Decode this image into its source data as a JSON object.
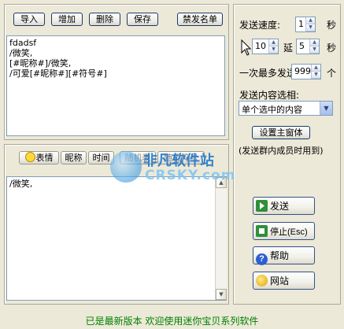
{
  "toolbar": {
    "import": "导入",
    "add": "增加",
    "delete": "删除",
    "save": "保存",
    "ban_list": "禁发名单"
  },
  "top_text": "fdadsf\n/微笑,\n[#昵称#]/微笑,\n/可爱[#昵称#][#符号#]",
  "insert_bar": {
    "emoticon": "表情",
    "nickname": "昵称",
    "time": "时间",
    "random_face": "随机表",
    "random_symbol": "随机符号"
  },
  "bottom_text": "/微笑,",
  "settings": {
    "speed_label": "发送速度:",
    "speed_value": "1",
    "seconds": "秒",
    "delay_from": "10",
    "delay_word": "延",
    "delay_to": "5",
    "seconds2": "秒",
    "batch_label": "一次最多发送",
    "batch_value": "999",
    "batch_unit": "个",
    "content_option_label": "发送内容选相:",
    "content_option_value": "单个选中的内容",
    "set_main_window": "设置主窗体",
    "hint": "(发送群内成员时用到)"
  },
  "actions": {
    "send": "发送",
    "stop": "停止(Esc)",
    "help": "帮助",
    "website": "网站"
  },
  "watermark": {
    "cn": "非凡软件站",
    "en": "CRSKY.com"
  },
  "status": "已是最新版本 欢迎使用迷你宝贝系列软件",
  "colors": {
    "status": "#008000",
    "window_bg": "#ece9d8",
    "border_blue": "#7f9db9"
  }
}
